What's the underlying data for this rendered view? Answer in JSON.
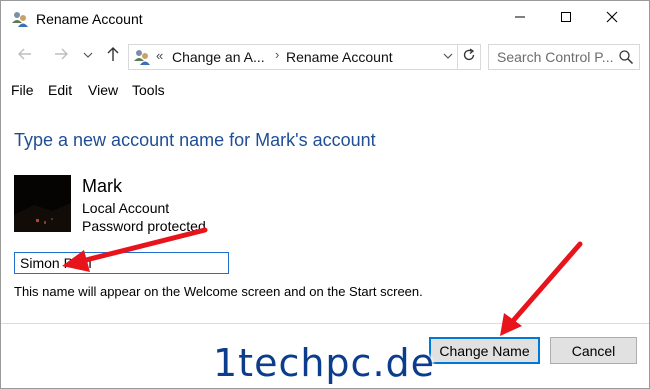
{
  "window": {
    "title": "Rename Account",
    "app_icon": "user-accounts-icon",
    "controls": [
      "minimize-icon",
      "maximize-icon",
      "close-icon"
    ]
  },
  "navigation": {
    "back_icon": "arrow-left-icon",
    "forward_icon": "arrow-right-icon",
    "recent_icon": "chevron-down-icon",
    "up_icon": "arrow-up-icon",
    "address": {
      "icon": "user-accounts-icon",
      "overflow": "«",
      "breadcrumbs": [
        "Change an A...",
        "Rename Account"
      ],
      "separator": "›",
      "dropdown_icon": "chevron-down-icon",
      "refresh_icon": "refresh-icon"
    },
    "search": {
      "placeholder": "Search Control P...",
      "icon": "search-icon"
    }
  },
  "menu": {
    "items": [
      "File",
      "Edit",
      "View",
      "Tools"
    ]
  },
  "content": {
    "heading": "Type a new account name for Mark's account",
    "account": {
      "name": "Mark",
      "type": "Local Account",
      "protection": "Password protected"
    },
    "new_name_value": "Simon Paul",
    "hint": "This name will appear on the Welcome screen and on the Start screen."
  },
  "buttons": {
    "change_name": "Change Name",
    "cancel": "Cancel"
  },
  "watermark": "1techpc.de",
  "colors": {
    "heading": "#1f4e96",
    "accent": "#0078d7",
    "annotation_arrow": "#e8141b",
    "button_face": "#e1e1e1"
  }
}
